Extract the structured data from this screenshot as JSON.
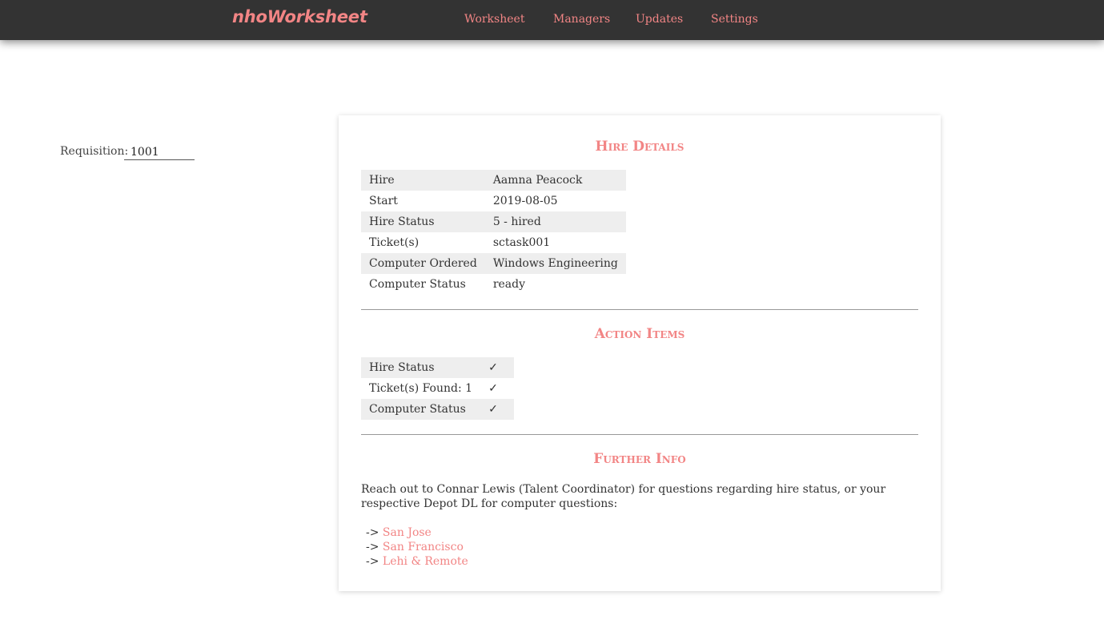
{
  "app": {
    "brand": "nhoWorksheet",
    "nav": [
      "Worksheet",
      "Managers",
      "Updates",
      "Settings"
    ]
  },
  "requisition": {
    "label": "Requisition:",
    "value": "1001"
  },
  "hire_details": {
    "title": "Hire Details",
    "rows": [
      {
        "label": "Hire",
        "value": "Aamna Peacock"
      },
      {
        "label": "Start",
        "value": "2019-08-05"
      },
      {
        "label": "Hire Status",
        "value": "5 - hired"
      },
      {
        "label": "Ticket(s)",
        "value": "sctask001"
      },
      {
        "label": "Computer Ordered",
        "value": "Windows Engineering"
      },
      {
        "label": "Computer Status",
        "value": "ready"
      }
    ]
  },
  "action_items": {
    "title": "Action Items",
    "rows": [
      {
        "label": "Hire Status",
        "value": "✓"
      },
      {
        "label": "Ticket(s) Found: 1",
        "value": "✓"
      },
      {
        "label": "Computer Status",
        "value": "✓"
      }
    ]
  },
  "further_info": {
    "title": "Further Info",
    "text": "Reach out to Connar Lewis (Talent Coordinator) for questions regarding hire status, or your respective Depot DL for computer questions:",
    "arrow": "->",
    "links": [
      "San Jose",
      "San Francisco",
      "Lehi & Remote"
    ]
  },
  "colors": {
    "accent": "#f28585",
    "navbar": "#333333",
    "row_shade": "#eeeeee"
  }
}
